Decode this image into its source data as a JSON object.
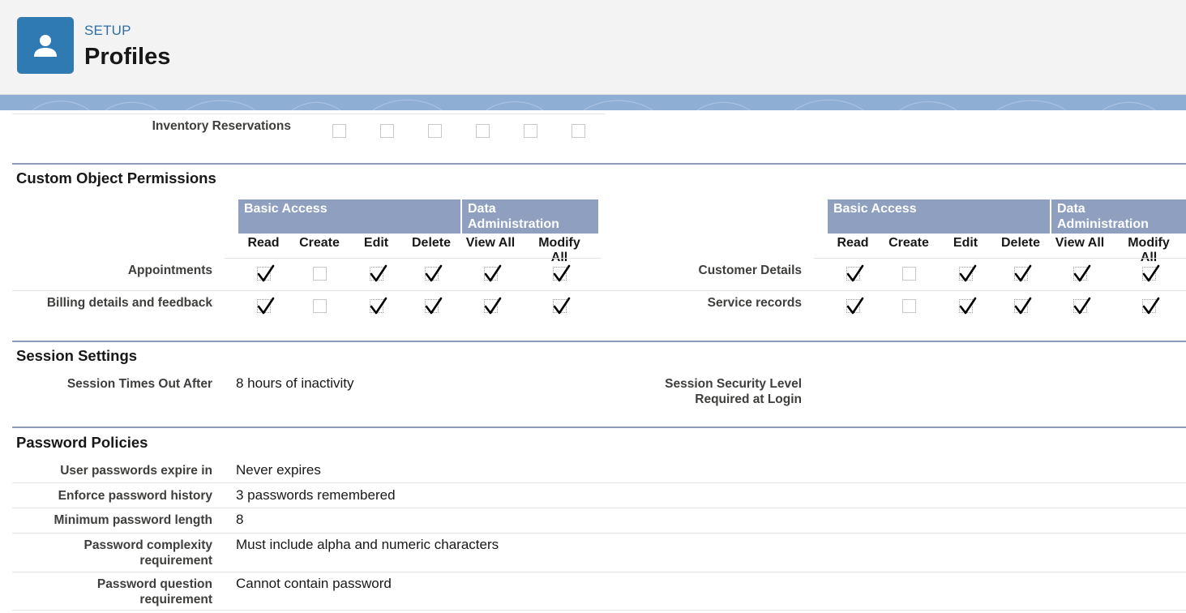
{
  "header": {
    "section": "SETUP",
    "title": "Profiles",
    "icon": "user-icon"
  },
  "inventory": {
    "label": "Inventory Reservations",
    "checks": [
      false,
      false,
      false,
      false,
      false,
      false
    ]
  },
  "custom_object_permissions": {
    "title": "Custom Object Permissions",
    "group_basic": "Basic Access",
    "group_data_line1": "Data",
    "group_data_line2": "Administration",
    "columns": [
      "Read",
      "Create",
      "Edit",
      "Delete",
      "View All",
      "Modify All"
    ],
    "left_rows": [
      {
        "label": "Appointments",
        "checks": [
          true,
          false,
          true,
          true,
          true,
          true
        ]
      },
      {
        "label": "Billing details and feedback",
        "checks": [
          true,
          false,
          true,
          true,
          true,
          true
        ]
      }
    ],
    "right_rows": [
      {
        "label": "Customer Details",
        "checks": [
          true,
          false,
          true,
          true,
          true,
          true
        ]
      },
      {
        "label": "Service records",
        "checks": [
          true,
          false,
          true,
          true,
          true,
          true
        ]
      }
    ]
  },
  "session": {
    "title": "Session Settings",
    "timeout_label": "Session Times Out After",
    "timeout_value": "8 hours of inactivity",
    "security_label_line1": "Session Security Level",
    "security_label_line2": "Required at Login",
    "security_value": ""
  },
  "password": {
    "title": "Password Policies",
    "rows": [
      {
        "label_line1": "User passwords expire in",
        "label_line2": "",
        "value": "Never expires"
      },
      {
        "label_line1": "Enforce password history",
        "label_line2": "",
        "value": "3 passwords remembered"
      },
      {
        "label_line1": "Minimum password length",
        "label_line2": "",
        "value": "8"
      },
      {
        "label_line1": "Password complexity",
        "label_line2": "requirement",
        "value": "Must include alpha and numeric characters"
      },
      {
        "label_line1": "Password question",
        "label_line2": "requirement",
        "value": "Cannot contain password"
      }
    ]
  },
  "colors": {
    "header_bg": "#f3f3f3",
    "icon_bg": "#2f7ab2",
    "band": "#8eaed4",
    "group_header": "#8e9fc0",
    "section_rule": "#8d9bb6"
  }
}
